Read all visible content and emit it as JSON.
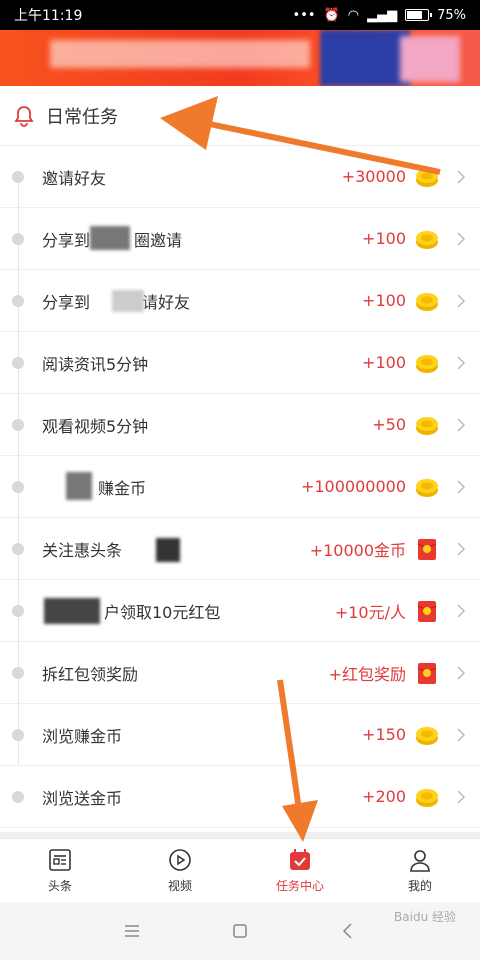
{
  "status_bar": {
    "time": "上午11:19",
    "battery": "75%"
  },
  "section": {
    "title": "日常任务"
  },
  "tasks": [
    {
      "label": "邀请好友",
      "reward": "+30000",
      "icon": "coin-icon"
    },
    {
      "label": "分享到",
      "label2": "圈邀请",
      "reward": "+100",
      "icon": "coin-icon"
    },
    {
      "label": "分享到",
      "label2": "邀请好友",
      "reward": "+100",
      "icon": "coin-icon"
    },
    {
      "label": "阅读资讯5分钟",
      "reward": "+100",
      "icon": "coin-icon"
    },
    {
      "label": "观看视频5分钟",
      "reward": "+50",
      "icon": "coin-icon"
    },
    {
      "label": "赚金币",
      "reward": "+100000000",
      "icon": "coin-icon"
    },
    {
      "label": "关注惠头条",
      "reward": "+10000金币",
      "icon": "red-envelope-icon"
    },
    {
      "label": "户领取10元红包",
      "reward": "+10元/人",
      "icon": "red-envelope-icon"
    },
    {
      "label": "拆红包领奖励",
      "reward": "+红包奖励",
      "icon": "red-envelope-icon"
    },
    {
      "label": "浏览赚金币",
      "reward": "+150",
      "icon": "coin-icon"
    },
    {
      "label": "浏览送金币",
      "reward": "+200",
      "icon": "coin-icon"
    }
  ],
  "tabs": [
    {
      "label": "头条",
      "icon": "news-icon",
      "active": false
    },
    {
      "label": "视频",
      "icon": "play-icon",
      "active": false
    },
    {
      "label": "任务中心",
      "icon": "calendar-check-icon",
      "active": true
    },
    {
      "label": "我的",
      "icon": "user-icon",
      "active": false
    }
  ],
  "watermark": "Baidu 经验",
  "colors": {
    "accent": "#e03a3a",
    "banner": "#f23b1f",
    "arrow": "#f07a2b"
  }
}
